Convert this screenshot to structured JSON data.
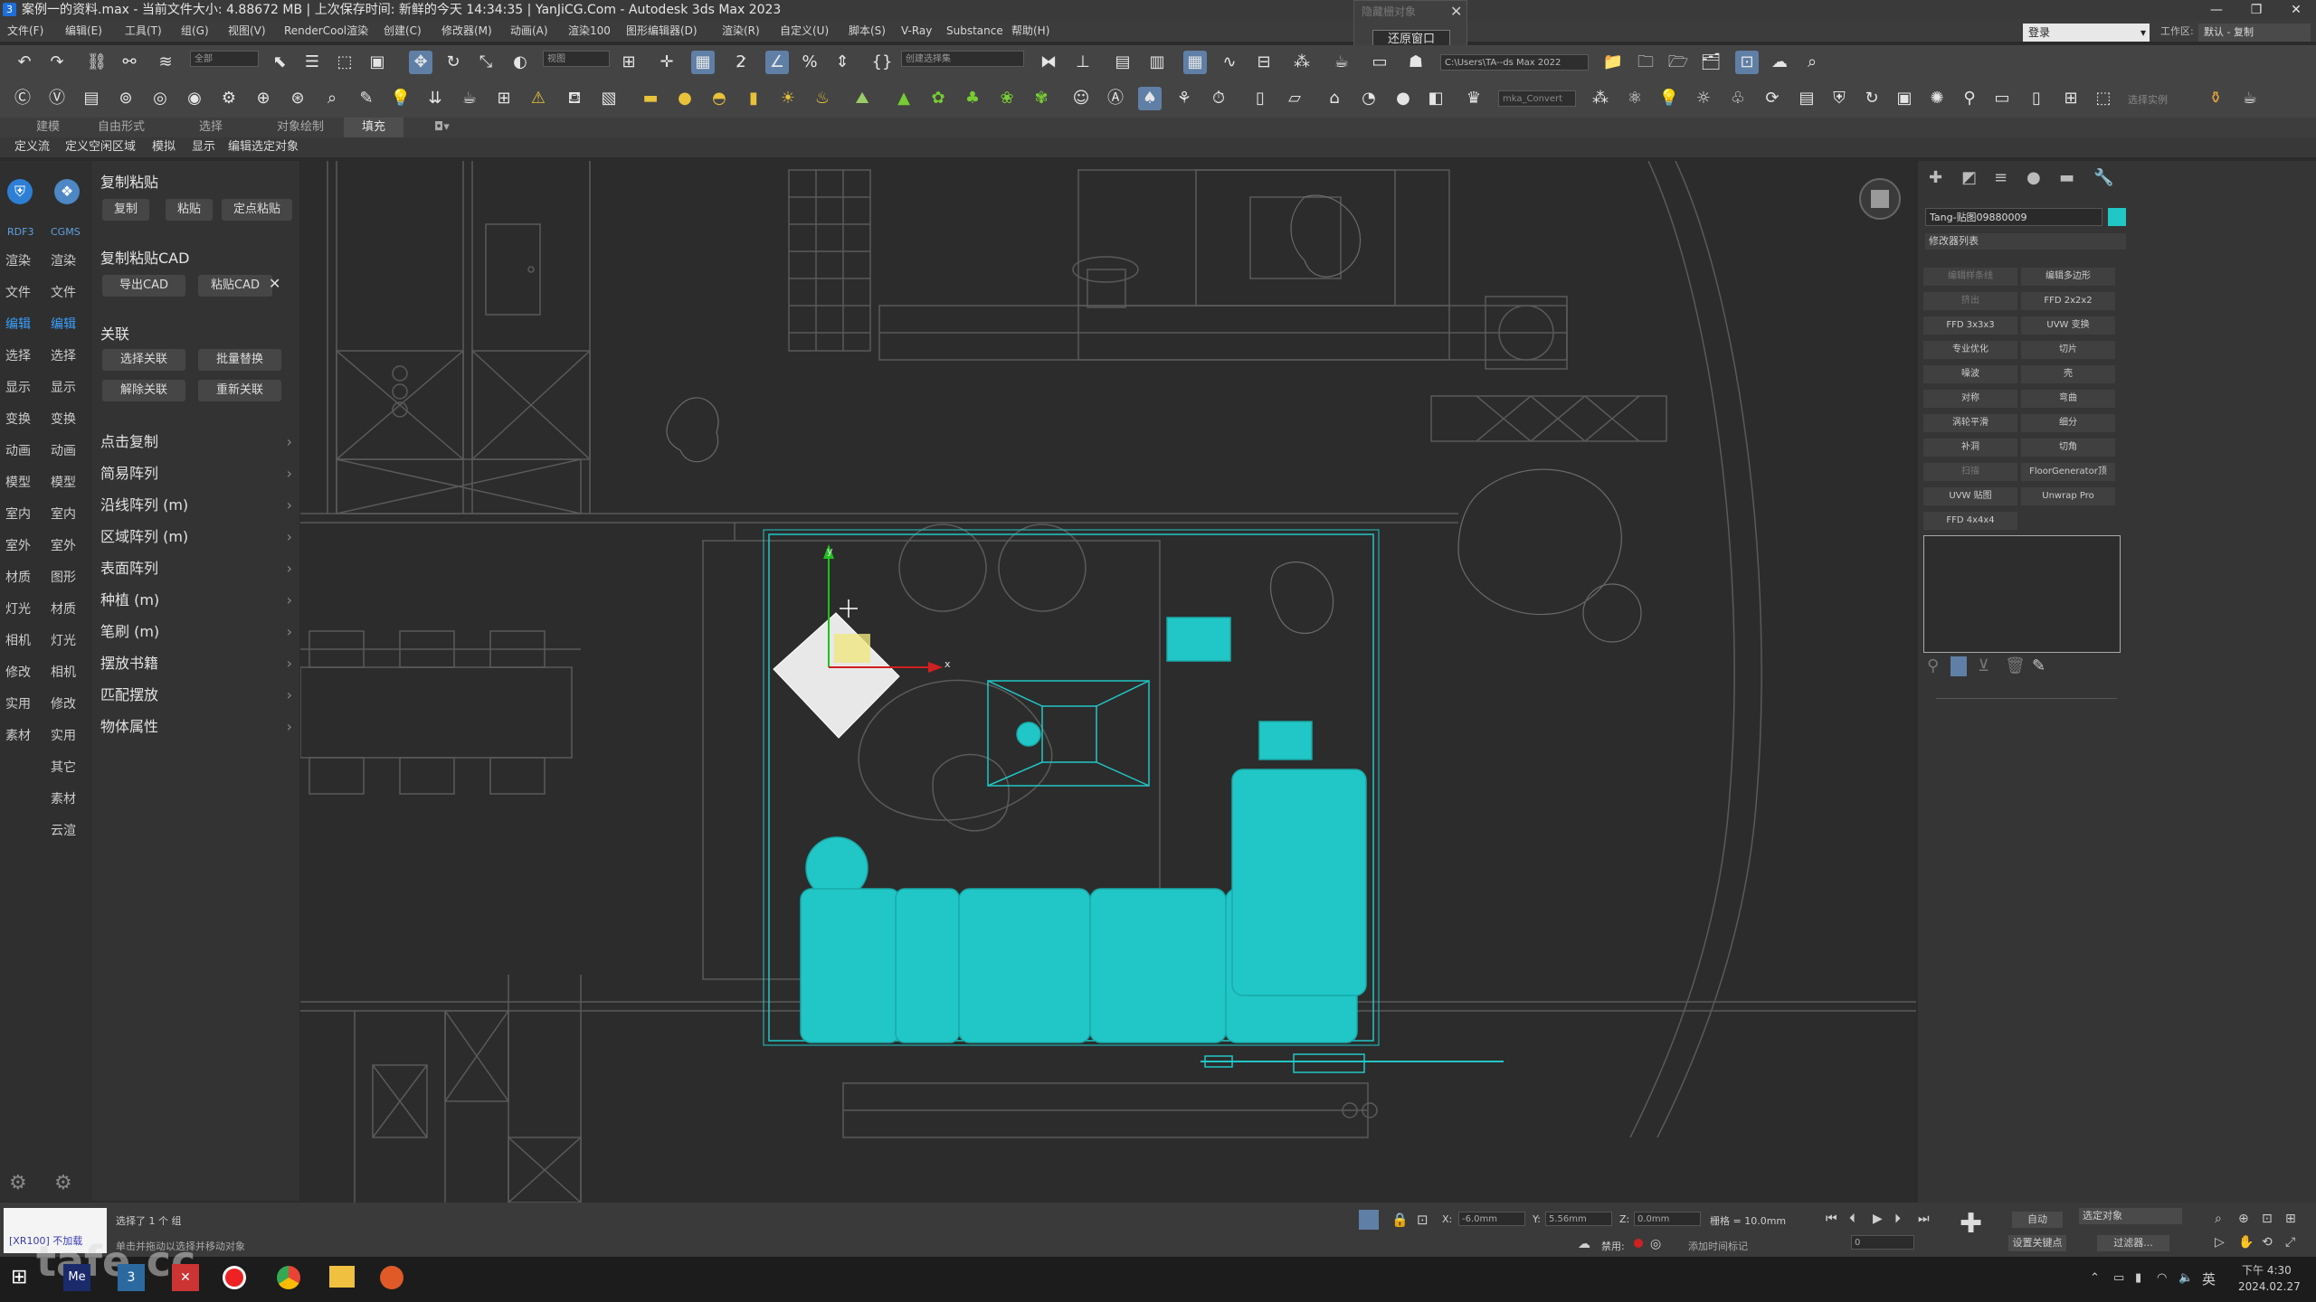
{
  "window": {
    "title": "案例一的资料.max - 当前文件大小: 4.88672 MB | 上次保存时间: 新鲜的今天 14:34:35 | YanJiCG.Com - Autodesk 3ds Max 2023",
    "minimize": "—",
    "restore": "❐",
    "close": "✕"
  },
  "popup": {
    "title": "隐藏栅对象",
    "close": "✕",
    "restore_label": "还原窗口"
  },
  "menu": [
    "文件(F)",
    "编辑(E)",
    "工具(T)",
    "组(G)",
    "视图(V)",
    "RenderCool渲染",
    "创建(C)",
    "修改器(M)",
    "动画(A)",
    "渲染100",
    "图形编辑器(D)",
    "渲染(R)",
    "自定义(U)",
    "脚本(S)",
    "V-Ray",
    "Substance",
    "帮助(H)"
  ],
  "login": {
    "label": "登录",
    "workspace_label": "工作区:",
    "workspace_value": "默认 - 复制"
  },
  "toolbar": {
    "selection_filter": "全部",
    "ref_coord": "视图",
    "named_selection": "创建选择集",
    "path_field": "C:\\Users\\TA--ds Max 2022",
    "converter": "mka_Convert",
    "select_tool": "选择实例"
  },
  "ribbon": {
    "tabs": [
      "建模",
      "自由形式",
      "选择",
      "对象绘制",
      "填充"
    ],
    "active": "填充",
    "subtabs": [
      "定义流",
      "定义空闲区域",
      "模拟",
      "显示",
      "编辑选定对象"
    ]
  },
  "left_categories": {
    "col1": [
      "渲染",
      "文件",
      "编辑",
      "选择",
      "显示",
      "变换",
      "动画",
      "模型",
      "室内",
      "室外",
      "材质",
      "灯光",
      "相机",
      "修改",
      "实用",
      "素材"
    ],
    "col2": [
      "渲染",
      "文件",
      "编辑",
      "选择",
      "显示",
      "变换",
      "动画",
      "模型",
      "室内",
      "室外",
      "图形",
      "材质",
      "灯光",
      "相机",
      "修改",
      "实用",
      "其它",
      "素材",
      "云渲"
    ],
    "active": "编辑",
    "badges": [
      "RDF3",
      "CGMS"
    ]
  },
  "plugin": {
    "copy_paste": {
      "title": "复制粘贴",
      "buttons": [
        "复制",
        "粘贴",
        "定点粘贴"
      ]
    },
    "cad": {
      "title": "复制粘贴CAD",
      "buttons": [
        "导出CAD",
        "粘贴CAD"
      ]
    },
    "link": {
      "title": "关联",
      "buttons": [
        "选择关联",
        "批量替换",
        "解除关联",
        "重新关联"
      ]
    },
    "rows": [
      "点击复制",
      "简易阵列",
      "沿线阵列 (m)",
      "区域阵列 (m)",
      "表面阵列",
      "种植 (m)",
      "笔刷 (m)",
      "摆放书籍",
      "匹配摆放",
      "物体属性"
    ]
  },
  "viewport": {
    "gizmo_x": "x",
    "gizmo_y": "y",
    "accent": "#21c7c7"
  },
  "command_panel": {
    "object_name": "Tang-贴图09880009",
    "modifier_list": "修改器列表",
    "modifier_buttons": [
      "编辑样条线",
      "编辑多边形",
      "挤出",
      "FFD 2x2x2",
      "FFD 3x3x3",
      "UVW 变换",
      "专业优化",
      "切片",
      "噪波",
      "壳",
      "对称",
      "弯曲",
      "涡轮平滑",
      "细分",
      "补洞",
      "切角",
      "扫描",
      "FloorGenerator顶",
      "UVW 贴图",
      "Unwrap Pro",
      "FFD 4x4x4"
    ]
  },
  "status": {
    "maxscript": "[XR100] 不加载",
    "selected": "选择了 1 个 组",
    "prompt": "单击并拖动以选择并移动对象",
    "x_label": "X:",
    "x_value": "-6.0mm",
    "y_label": "Y:",
    "y_value": "5.56mm",
    "z_label": "Z:",
    "z_value": "0.0mm",
    "grid": "栅格 = 10.0mm",
    "disabled": "禁用:",
    "add_time_tag": "添加时间标记",
    "auto": "自动",
    "set_key": "设置关键点",
    "selected_objects": "选定对象",
    "filter": "过滤器...",
    "frame": "0"
  },
  "watermark": "tafe.cc",
  "taskbar": {
    "time": "下午 4:30",
    "date": "2024.02.27",
    "ime": "英"
  }
}
